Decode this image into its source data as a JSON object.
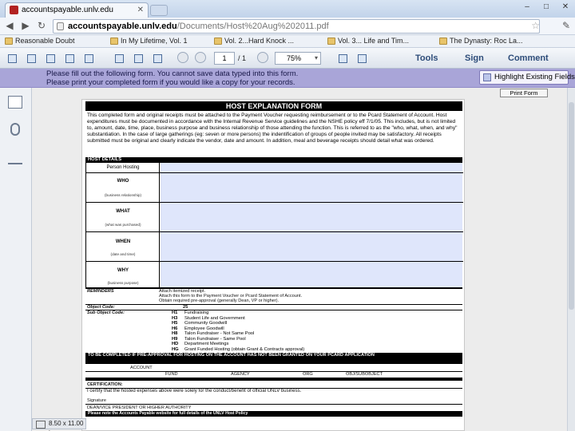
{
  "browser": {
    "tab_title": "accountspayable.unlv.edu",
    "url_host": "accountspayable.unlv.edu",
    "url_path": "/Documents/Host%20Aug%202011.pdf",
    "bookmarks": [
      "Reasonable Doubt",
      "In My Lifetime, Vol. 1",
      "Vol. 2...Hard Knock ...",
      "Vol. 3... Life and Tim...",
      "The Dynasty: Roc La..."
    ]
  },
  "pdf_toolbar": {
    "page_current": "1",
    "page_total": "/ 1",
    "zoom": "75%",
    "pane_tools": "Tools",
    "pane_sign": "Sign",
    "pane_comment": "Comment"
  },
  "notice": {
    "line1": "Please fill out the following form. You cannot save data typed into this form.",
    "line2": "Please print your completed form if you would like a copy for your records.",
    "highlight_button": "Highlight Existing Fields"
  },
  "form": {
    "print_button": "Print Form",
    "title": "HOST EXPLANATION FORM",
    "intro": "This completed form and original receipts must be attached to the Payment Voucher requesting reimbursement or to the Pcard Statement of Account. Host expenditures must be documented in accordance with the Internal Revenue Service guidelines and the NSHE policy eff 7/1/05. This includes, but is not limited to, amount, date, time, place, business purpose and business relationship of those attending the function. This is referred to as the \"who, what, when, and why\" substantiation. In the case of large gatherings (eg: seven or more persons) the indentification of groups of people invited may be satisfactory. All receipts submitted must be original and clearly indicate the vendor, date and amount. In addition, meal and beverage receipts should detail what was ordered.",
    "host_details_header": "HOST DETAILS",
    "rows": [
      {
        "label": "Person Hosting",
        "sub": ""
      },
      {
        "label": "WHO",
        "sub": "(business relationship)"
      },
      {
        "label": "WHAT",
        "sub": "(what was purchased)"
      },
      {
        "label": "WHEN",
        "sub": "(date and time)"
      },
      {
        "label": "WHY",
        "sub": "(business purpose)"
      }
    ],
    "reminders_label": "REMINDERS",
    "reminders": [
      "Attach itemized receipt.",
      "Attach this form to the Payment Voucher or Pcard Statement of Account.",
      "Obtain required pre-approval (generally Dean, VP or higher)."
    ],
    "object_code_label": "Object Code:",
    "object_code_value": "25",
    "sub_object_label": "Sub Object Code:",
    "sub_object_codes": [
      {
        "code": "H1",
        "desc": "Fundraising"
      },
      {
        "code": "H3",
        "desc": "Student Life and Government"
      },
      {
        "code": "H5",
        "desc": "Community Goodwill"
      },
      {
        "code": "H6",
        "desc": "Employee Goodwill"
      },
      {
        "code": "H8",
        "desc": "Talon Fundraiser - Not Same Pool"
      },
      {
        "code": "H9",
        "desc": "Talon Fundraiser - Same Pool"
      },
      {
        "code": "HD",
        "desc": "Department Meetings"
      },
      {
        "code": "HG",
        "desc": "Grant Funded Hosting (obtain Grant & Contracts approval)"
      }
    ],
    "approval_header": "TO BE COMPLETED IF PRE-APPROVAL FOR HOSTING ON THE ACCOUNT HAS NOT BEEN GRANTED ON YOUR PCARD APPLICATION",
    "account_label": "ACCOUNT",
    "account_cols": [
      "FUND",
      "AGENCY",
      "ORG",
      "OBJ/SUBOBJECT"
    ],
    "certification_header": "CERTIFICATION:",
    "certification_text": "I certify that the hosted expenses above were solely for the conduct/benefit of official UNLV business.",
    "signature_label": "Signature",
    "dean_label": "DEAN/VICE PRESIDENT OR HIGHER AUTHORITY",
    "footer_bar": "Please note the Accounts Payable website for full details of the UNLV Host Policy"
  },
  "status": {
    "page_size": "8.50 x 11.00 in"
  }
}
